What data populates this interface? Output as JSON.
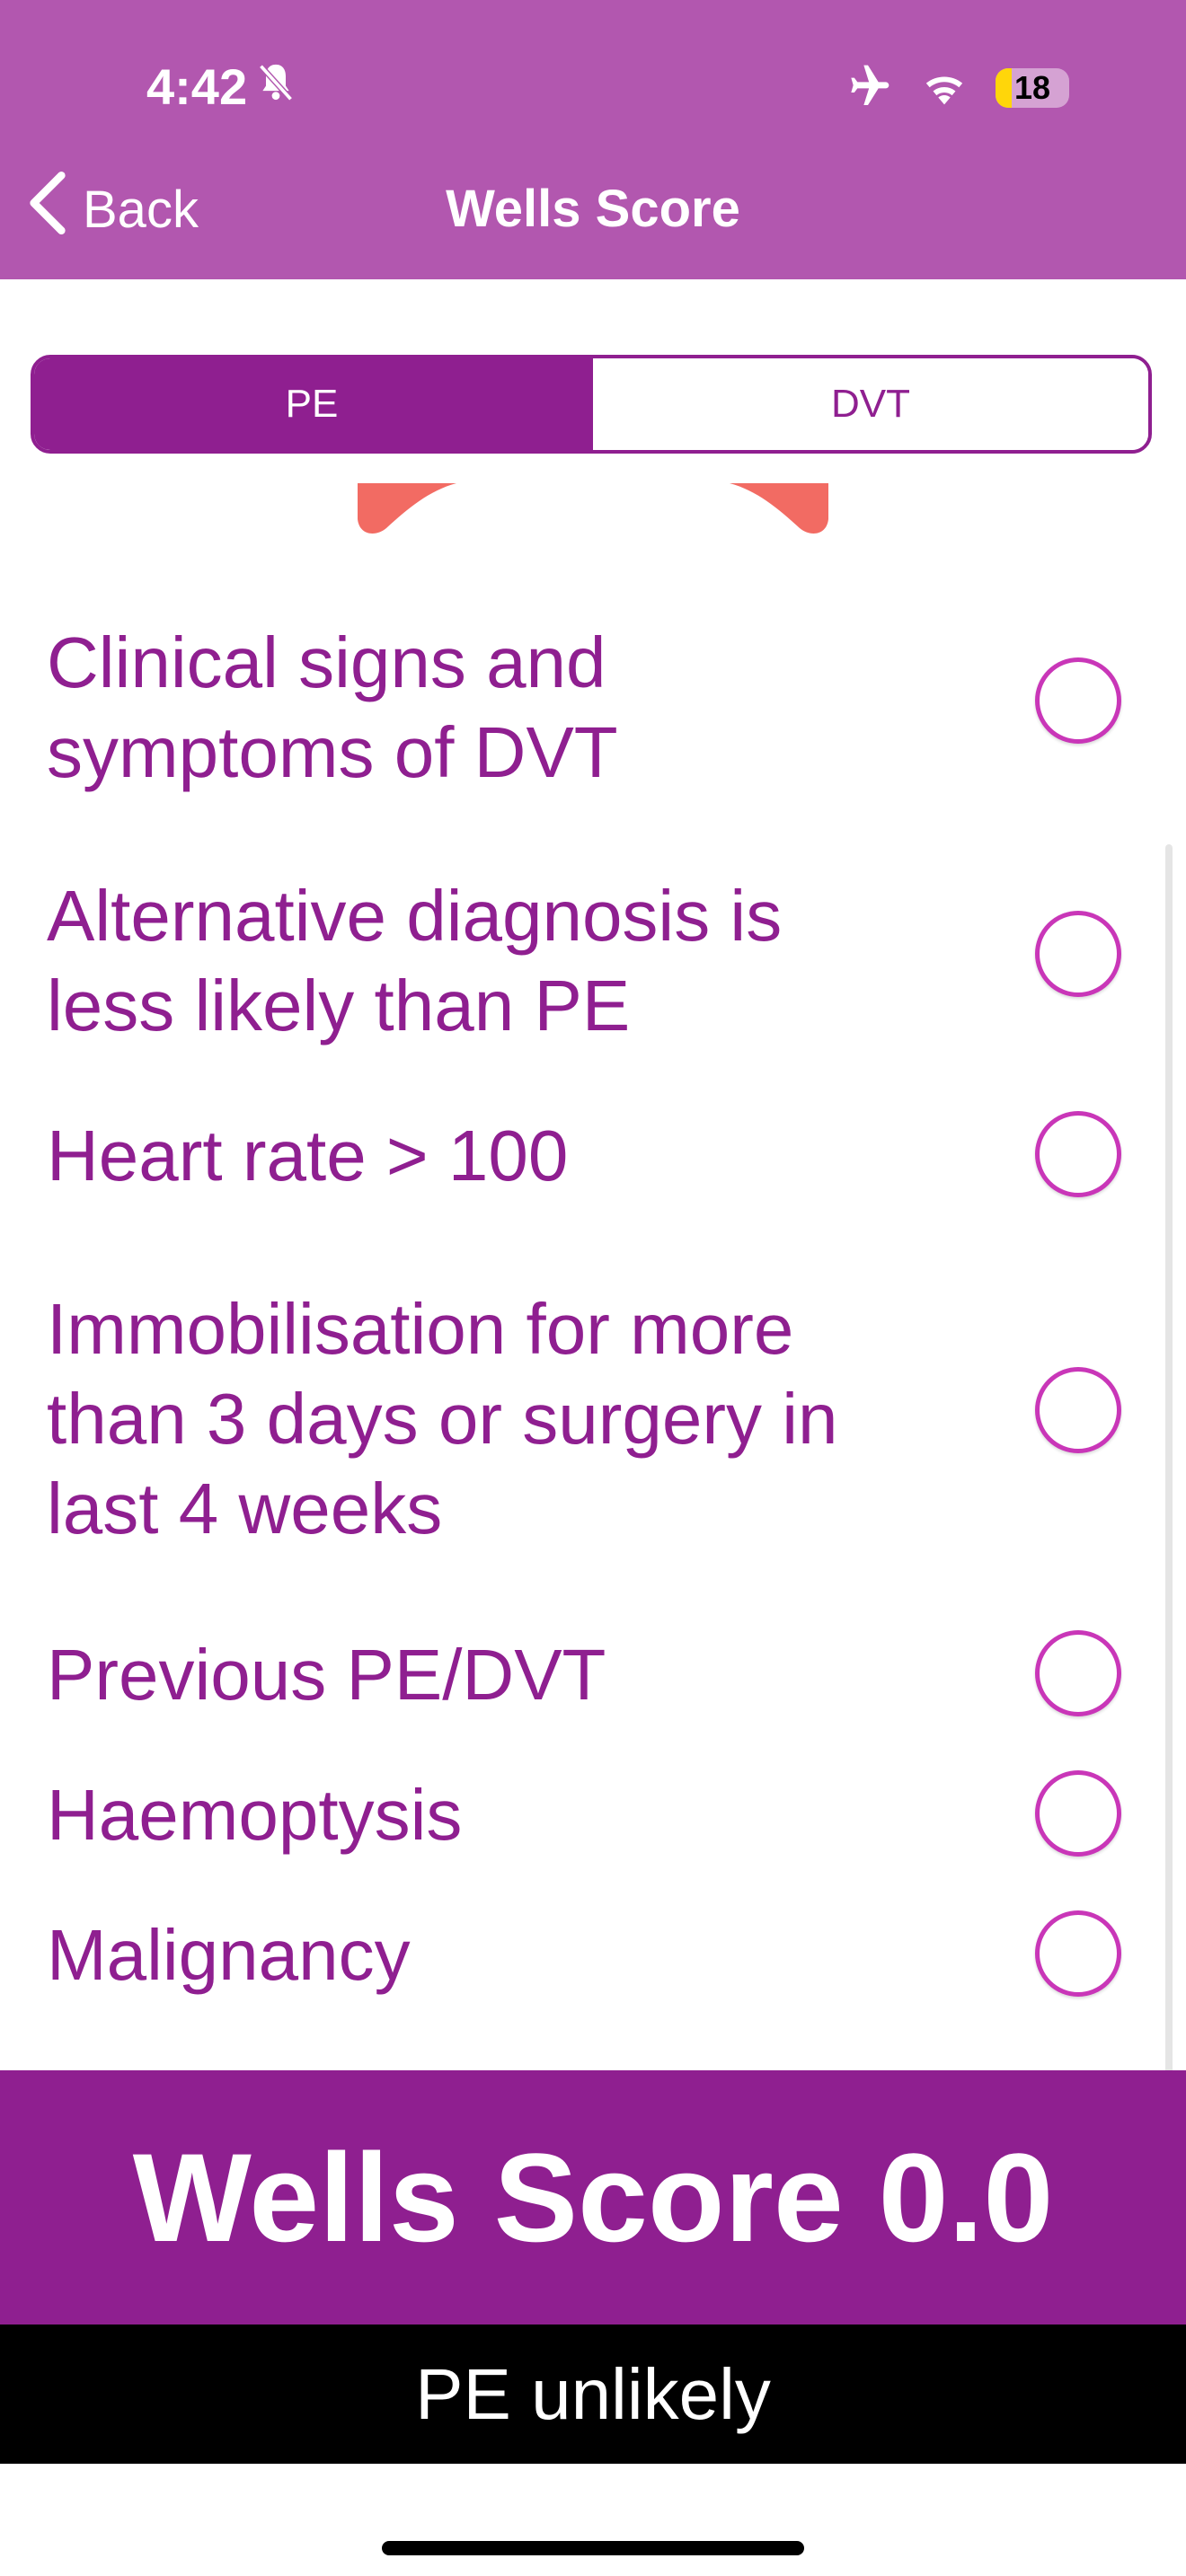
{
  "status_bar": {
    "time": "4:42",
    "battery_level": "18",
    "icons": [
      "silent-mode-icon",
      "airplane-icon",
      "wifi-icon",
      "battery-icon"
    ]
  },
  "nav": {
    "back_label": "Back",
    "title": "Wells Score"
  },
  "segments": {
    "selected": "PE",
    "items": [
      {
        "label": "PE"
      },
      {
        "label": "DVT"
      }
    ]
  },
  "criteria": [
    {
      "label": "Clinical signs and symptoms of DVT",
      "checked": false
    },
    {
      "label": "Alternative diagnosis is less likely than PE",
      "checked": false
    },
    {
      "label": "Heart rate > 100",
      "checked": false
    },
    {
      "label": "Immobilisation for more than 3 days or surgery in  last 4 weeks",
      "checked": false
    },
    {
      "label": "Previous PE/DVT",
      "checked": false
    },
    {
      "label": "Haemoptysis",
      "checked": false
    },
    {
      "label": "Malignancy",
      "checked": false
    }
  ],
  "score": {
    "text": "Wells Score 0.0"
  },
  "result": {
    "text": "PE unlikely"
  },
  "colors": {
    "header": "#B257AF",
    "primary": "#8F1F90",
    "radio_border": "#C936B8",
    "blob": "#F26B63"
  }
}
